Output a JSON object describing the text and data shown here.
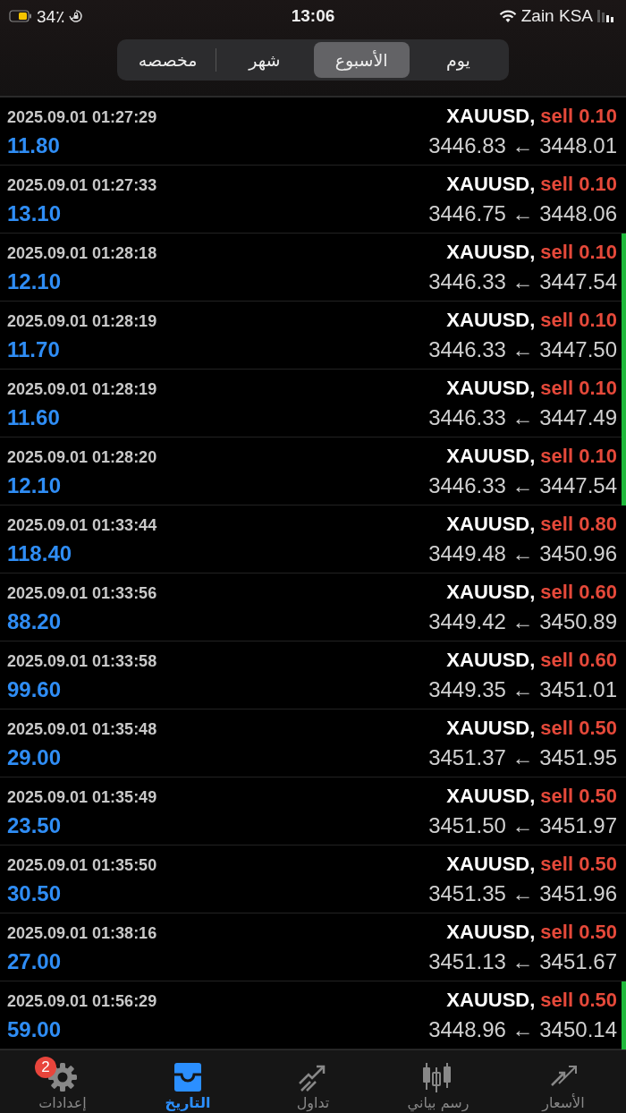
{
  "status_bar": {
    "battery": "34٪",
    "time": "13:06",
    "carrier": "Zain KSA"
  },
  "period_tabs": [
    {
      "label": "يوم",
      "selected": false
    },
    {
      "label": "الأسبوع",
      "selected": true
    },
    {
      "label": "شهر",
      "selected": false
    },
    {
      "label": "مخصصه",
      "selected": false
    }
  ],
  "deals": [
    {
      "time": "2025.09.01 01:27:29",
      "symbol": "XAUUSD,",
      "side": "sell 0.10",
      "profit": "11.80",
      "prices": "3446.83 ← 3448.01",
      "marked": false
    },
    {
      "time": "2025.09.01 01:27:33",
      "symbol": "XAUUSD,",
      "side": "sell 0.10",
      "profit": "13.10",
      "prices": "3446.75 ← 3448.06",
      "marked": false
    },
    {
      "time": "2025.09.01 01:28:18",
      "symbol": "XAUUSD,",
      "side": "sell 0.10",
      "profit": "12.10",
      "prices": "3446.33 ← 3447.54",
      "marked": true
    },
    {
      "time": "2025.09.01 01:28:19",
      "symbol": "XAUUSD,",
      "side": "sell 0.10",
      "profit": "11.70",
      "prices": "3446.33 ← 3447.50",
      "marked": true
    },
    {
      "time": "2025.09.01 01:28:19",
      "symbol": "XAUUSD,",
      "side": "sell 0.10",
      "profit": "11.60",
      "prices": "3446.33 ← 3447.49",
      "marked": true
    },
    {
      "time": "2025.09.01 01:28:20",
      "symbol": "XAUUSD,",
      "side": "sell 0.10",
      "profit": "12.10",
      "prices": "3446.33 ← 3447.54",
      "marked": true
    },
    {
      "time": "2025.09.01 01:33:44",
      "symbol": "XAUUSD,",
      "side": "sell 0.80",
      "profit": "118.40",
      "prices": "3449.48 ← 3450.96",
      "marked": false
    },
    {
      "time": "2025.09.01 01:33:56",
      "symbol": "XAUUSD,",
      "side": "sell 0.60",
      "profit": "88.20",
      "prices": "3449.42 ← 3450.89",
      "marked": false
    },
    {
      "time": "2025.09.01 01:33:58",
      "symbol": "XAUUSD,",
      "side": "sell 0.60",
      "profit": "99.60",
      "prices": "3449.35 ← 3451.01",
      "marked": false
    },
    {
      "time": "2025.09.01 01:35:48",
      "symbol": "XAUUSD,",
      "side": "sell 0.50",
      "profit": "29.00",
      "prices": "3451.37 ← 3451.95",
      "marked": false
    },
    {
      "time": "2025.09.01 01:35:49",
      "symbol": "XAUUSD,",
      "side": "sell 0.50",
      "profit": "23.50",
      "prices": "3451.50 ← 3451.97",
      "marked": false
    },
    {
      "time": "2025.09.01 01:35:50",
      "symbol": "XAUUSD,",
      "side": "sell 0.50",
      "profit": "30.50",
      "prices": "3451.35 ← 3451.96",
      "marked": false
    },
    {
      "time": "2025.09.01 01:38:16",
      "symbol": "XAUUSD,",
      "side": "sell 0.50",
      "profit": "27.00",
      "prices": "3451.13 ← 3451.67",
      "marked": false
    },
    {
      "time": "2025.09.01 01:56:29",
      "symbol": "XAUUSD,",
      "side": "sell 0.50",
      "profit": "59.00",
      "prices": "3448.96 ← 3450.14",
      "marked": true
    }
  ],
  "tab_bar": [
    {
      "kind": "quotes",
      "label": "الأسعار",
      "selected": false
    },
    {
      "kind": "chart",
      "label": "رسم بياني",
      "selected": false
    },
    {
      "kind": "trade",
      "label": "تداول",
      "selected": false
    },
    {
      "kind": "history",
      "label": "التاريخ",
      "selected": true
    },
    {
      "kind": "settings",
      "label": "إعدادات",
      "selected": false,
      "badge": "2"
    }
  ]
}
